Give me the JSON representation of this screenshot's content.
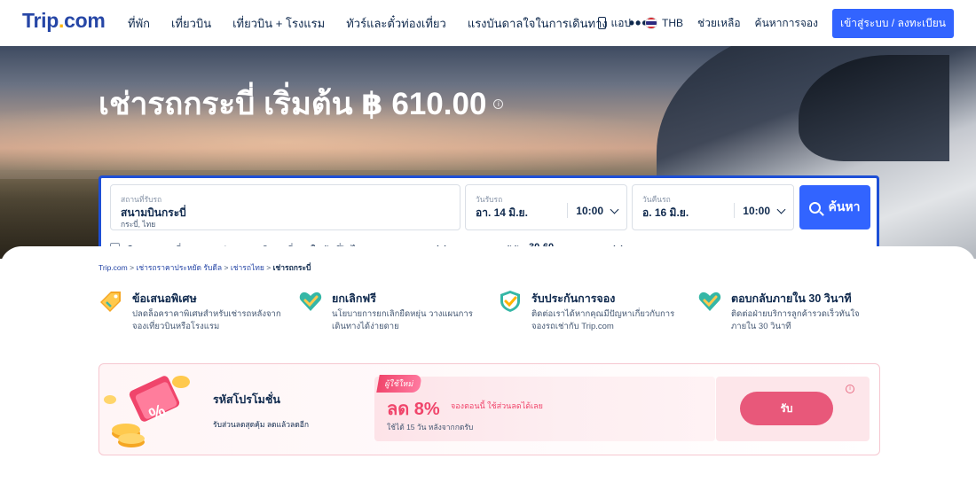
{
  "header": {
    "logo_main": "Trip",
    "logo_dot": ".",
    "logo_end": "com",
    "nav": [
      "ที่พัก",
      "เที่ยวบิน",
      "เที่ยวบิน + โรงแรม",
      "ทัวร์และตั๋วท่องเที่ยว",
      "แรงบันดาลใจในการเดินทาง"
    ],
    "more": "•••",
    "app_label": "แอป",
    "currency": "THB",
    "help": "ช่วยเหลือ",
    "find_booking": "ค้นหาการจอง",
    "login": "เข้าสู่ระบบ / ลงทะเบียน"
  },
  "hero": {
    "title": "เช่ารถกระบี่ เริ่มต้น ฿ 610.00",
    "info": "i"
  },
  "search": {
    "pickup_label": "สถานที่รับรถ",
    "pickup_value": "สนามบินกระบี่",
    "pickup_sub": "กระบี่, ไทย",
    "pickup_date_label": "วันรับรถ",
    "pickup_date": "อา. 14 มิ.ย.",
    "pickup_time": "10:00",
    "return_date_label": "วันคืนรถ",
    "return_date": "อ. 16 มิ.ย.",
    "return_time": "10:00",
    "search_button": "ค้นหา",
    "different_return": "คืนรถคนละที่",
    "country_label": "ประเทศ/ภูมิภาคที่ออกใบขับขี่",
    "country_value": "ไทย",
    "age_label": "อายุผู้ขับ",
    "age_value": "30-60"
  },
  "breadcrumb": {
    "items": [
      "Trip.com",
      "เช่ารถราคาประหยัด รับดีล",
      "เช่ารถไทย"
    ],
    "sep": ">",
    "current": "เช่ารถกระบี่"
  },
  "features": [
    {
      "title": "ข้อเสนอพิเศษ",
      "desc": "ปลดล็อคราคาพิเศษสำหรับเช่ารถหลังจากจองเที่ยวบินหรือโรงแรม"
    },
    {
      "title": "ยกเลิกฟรี",
      "desc": "นโยบายการยกเลิกยืดหยุ่น วางแผนการเดินทางได้ง่ายดาย"
    },
    {
      "title": "รับประกันการจอง",
      "desc": "ติดต่อเราได้หากคุณมีปัญหาเกี่ยวกับการจองรถเช่ากับ Trip.com"
    },
    {
      "title": "ตอบกลับภายใน 30 วินาที",
      "desc": "ติดต่อฝ่ายบริการลูกค้ารวดเร็วทันใจ ภายใน 30 วินาที"
    }
  ],
  "promo": {
    "title": "รหัสโปรโมชั่น",
    "subtitle": "รับส่วนลดสุดคุ้ม ลดแล้วลดอีก",
    "tag": "ผู้ใช้ใหม่",
    "discount": "ลด 8%",
    "desc": "จองตอนนี้ ใช้ส่วนลดได้เลย",
    "condition": "ใช้ได้ 15 วัน หลังจากกดรับ",
    "claim": "รับ",
    "info": "i"
  },
  "colors": {
    "brand": "#2646a6",
    "primary_button": "#3264ff",
    "promo_pink": "#f0456b",
    "claim_button": "#e8587a"
  }
}
